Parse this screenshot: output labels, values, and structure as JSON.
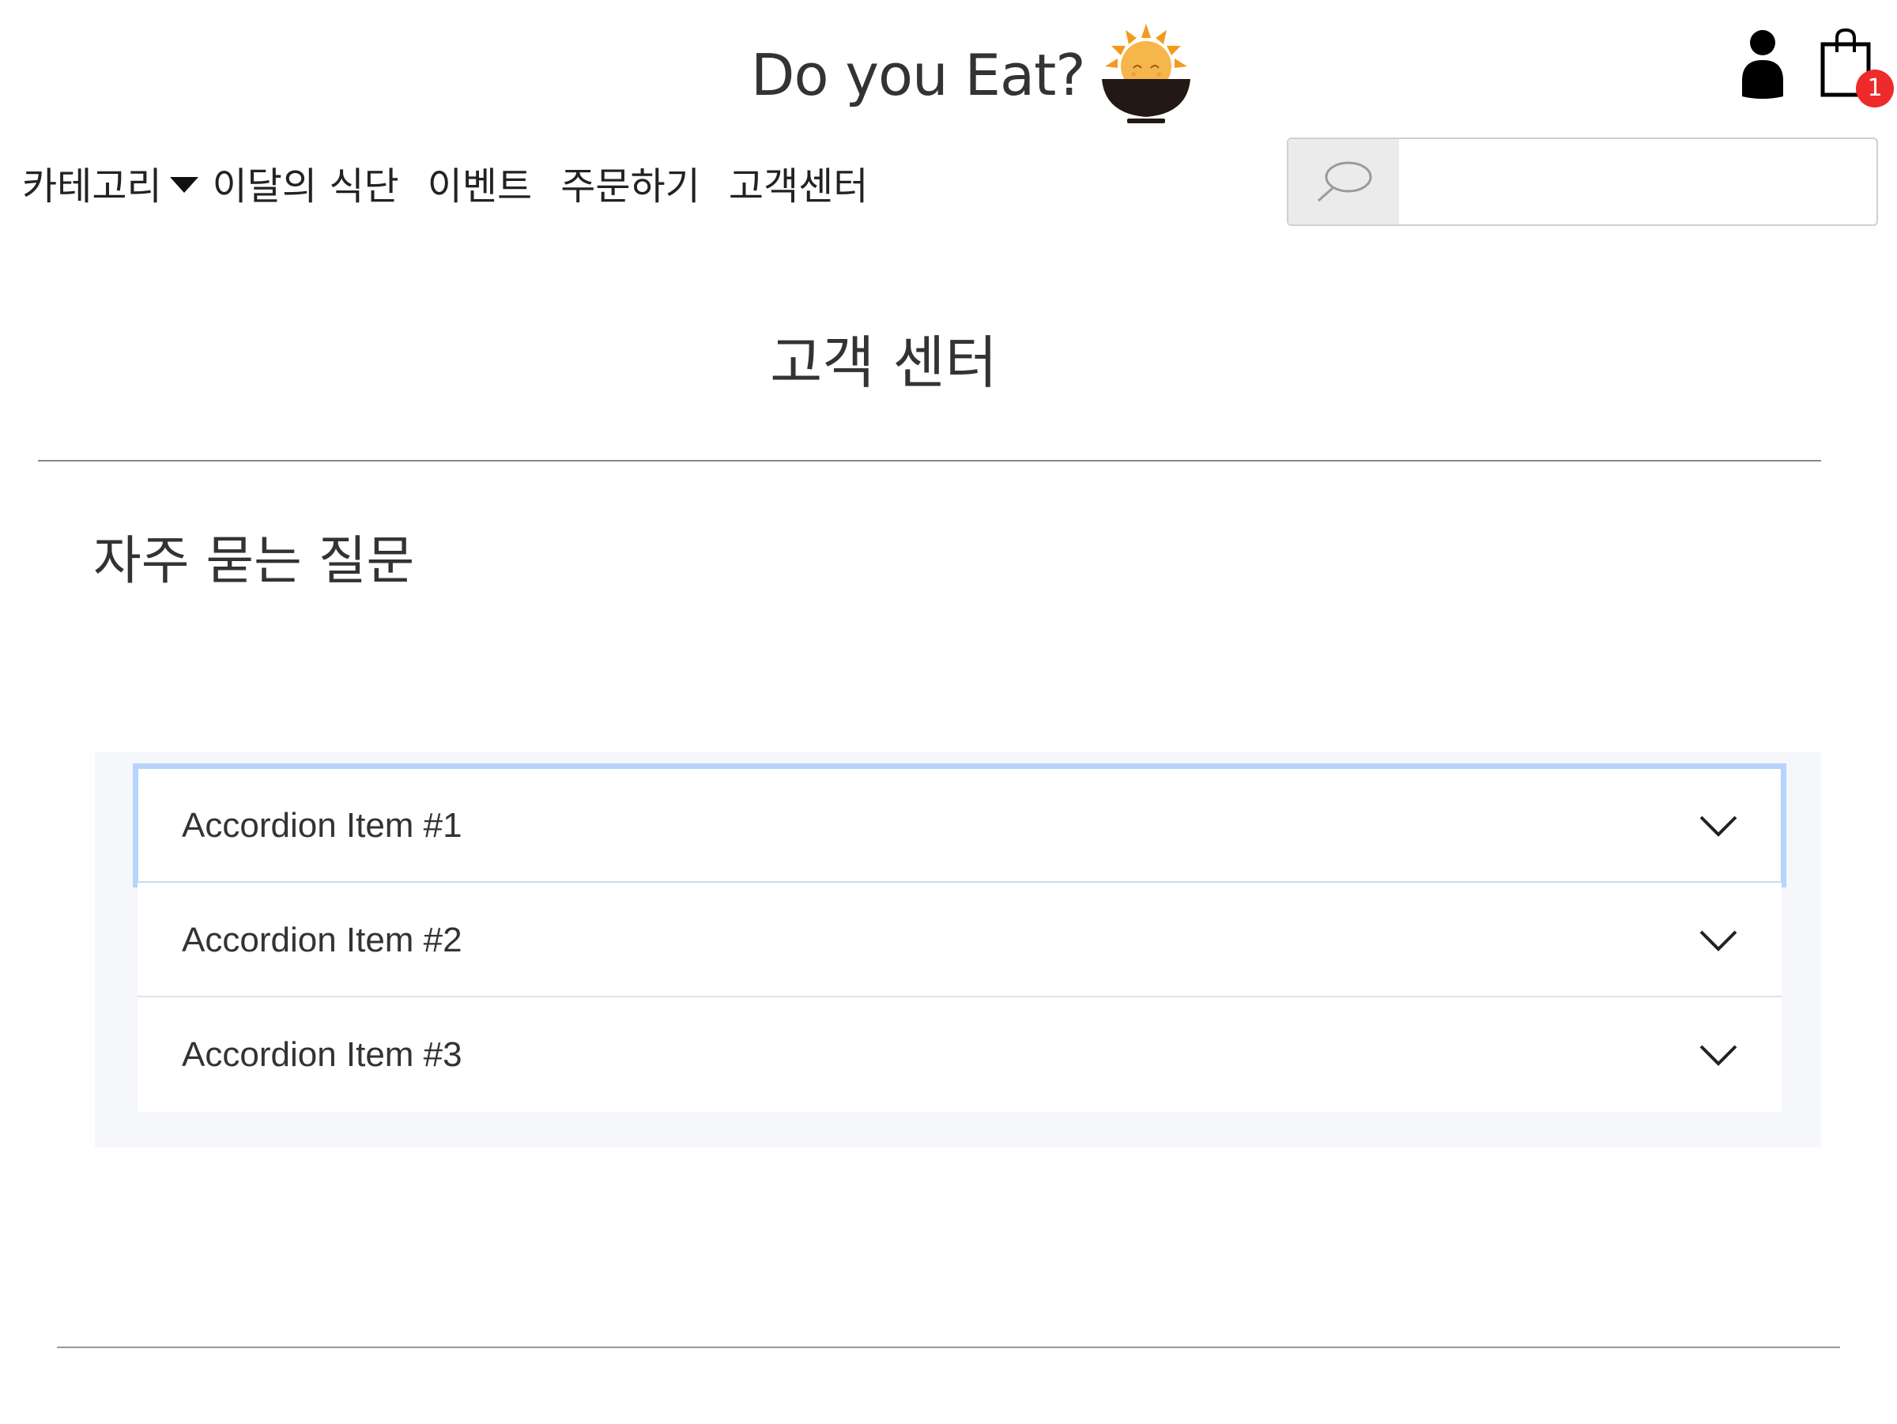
{
  "header": {
    "brand_title": "Do you Eat?",
    "cart_count": "1"
  },
  "nav": {
    "items": [
      {
        "label": "카테고리",
        "has_dropdown": true
      },
      {
        "label": "이달의 식단"
      },
      {
        "label": "이벤트"
      },
      {
        "label": "주문하기"
      },
      {
        "label": "고객센터"
      }
    ]
  },
  "search": {
    "placeholder": "",
    "value": ""
  },
  "page": {
    "title": "고객 센터",
    "section_title": "자주 묻는 질문"
  },
  "accordion": {
    "items": [
      {
        "label": "Accordion Item #1",
        "focused": true
      },
      {
        "label": "Accordion Item #2"
      },
      {
        "label": "Accordion Item #3"
      }
    ]
  },
  "colors": {
    "badge": "#ee2a2a",
    "focus_ring": "#b6d4fc",
    "accordion_bg": "#f5f7fa",
    "logo_orange": "#f39a1c",
    "bowl": "#231815"
  },
  "icons": [
    "brand-logo-icon",
    "user-icon",
    "shopping-bag-icon",
    "caret-down-icon",
    "search-icon",
    "chevron-down-icon"
  ]
}
